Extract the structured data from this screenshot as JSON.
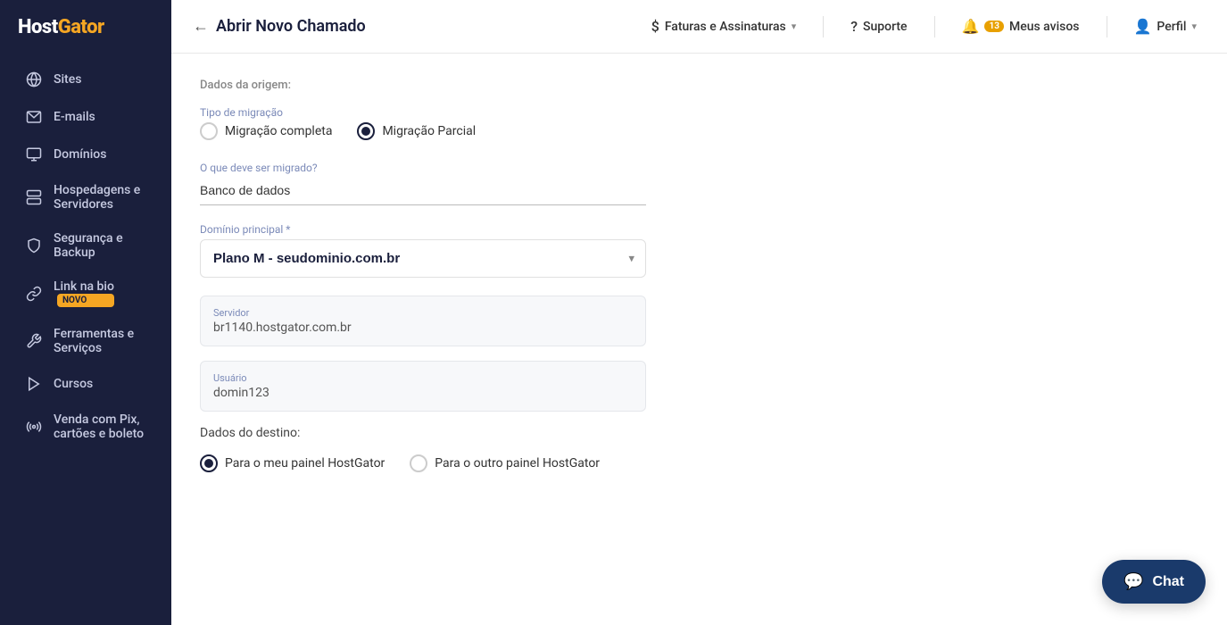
{
  "sidebar": {
    "logo": "HostGator",
    "items": [
      {
        "id": "sites",
        "label": "Sites",
        "icon": "globe"
      },
      {
        "id": "emails",
        "label": "E-mails",
        "icon": "email"
      },
      {
        "id": "dominios",
        "label": "Domínios",
        "icon": "domain"
      },
      {
        "id": "hospedagens",
        "label": "Hospedagens e",
        "label2": "Servidores",
        "icon": "server"
      },
      {
        "id": "seguranca",
        "label": "Segurança e",
        "label2": "Backup",
        "icon": "security"
      },
      {
        "id": "link-bio",
        "label": "Link na bio",
        "icon": "link",
        "badge": "NOVO"
      },
      {
        "id": "ferramentas",
        "label": "Ferramentas e",
        "label2": "Serviços",
        "icon": "tools"
      },
      {
        "id": "cursos",
        "label": "Cursos",
        "icon": "courses"
      },
      {
        "id": "venda-pix",
        "label": "Venda com Pix,",
        "label2": "cartões e boleto",
        "icon": "pix"
      }
    ]
  },
  "topbar": {
    "back_label": "Abrir Novo Chamado",
    "faturas_label": "Faturas e Assinaturas",
    "suporte_label": "Suporte",
    "avisos_label": "Meus avisos",
    "avisos_count": "13",
    "perfil_label": "Perfil"
  },
  "form": {
    "section_origem": "Dados da origem:",
    "tipo_migracao_label": "Tipo de migração",
    "radio_completa": "Migração completa",
    "radio_parcial": "Migração Parcial",
    "selected_tipo": "parcial",
    "o_que_migrar_label": "O que deve ser migrado?",
    "o_que_migrar_value": "Banco de dados",
    "dominio_label": "Domínio principal *",
    "dominio_value": "Plano M - seudominio.com.br",
    "servidor_label": "Servidor",
    "servidor_value": "br1140.hostgator.com.br",
    "usuario_label": "Usuário",
    "usuario_value": "domin123",
    "section_destino": "Dados do destino:",
    "radio_meu_painel": "Para o meu painel HostGator",
    "radio_outro_painel": "Para o outro painel HostGator",
    "selected_destino": "meu_painel"
  },
  "chat": {
    "label": "Chat",
    "icon": "chat-bubble"
  }
}
